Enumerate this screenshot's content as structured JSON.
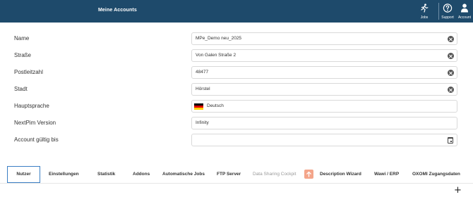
{
  "header": {
    "title": "Meine Accounts",
    "jobs_label": "Jobs",
    "support_label": "Support",
    "account_label": "Account",
    "background": "#1e4a6b"
  },
  "form": {
    "name": {
      "label": "Name",
      "value": "MPe_Demo neu_2025"
    },
    "street": {
      "label": "Straße",
      "value": "Von Galen Straße 2"
    },
    "zip": {
      "label": "Postleitzahl",
      "value": "48477"
    },
    "city": {
      "label": "Stadt",
      "value": "Hörstel"
    },
    "language": {
      "label": "Hauptsprache",
      "value": "Deutsch",
      "flag": "de-flag-icon"
    },
    "version": {
      "label": "NextPim Version",
      "value": "Infinity"
    },
    "valid_until": {
      "label": "Account gültig bis",
      "value": ""
    }
  },
  "tabs": [
    {
      "label": "Nutzer",
      "active": true
    },
    {
      "label": "Einstellungen"
    },
    {
      "label": "Statistik"
    },
    {
      "label": "Addons"
    },
    {
      "label": "Automatische Jobs"
    },
    {
      "label": "FTP Server"
    },
    {
      "label": "Data Sharing Cockpit",
      "disabled": true
    },
    {
      "label": "Description Wizard"
    },
    {
      "label": "Wawi / ERP"
    },
    {
      "label": "OXOMI Zugangsdaten"
    }
  ],
  "add_button": "+",
  "colors": {
    "accent": "#3b7fc4",
    "upload_badge": "#f4a58a"
  }
}
